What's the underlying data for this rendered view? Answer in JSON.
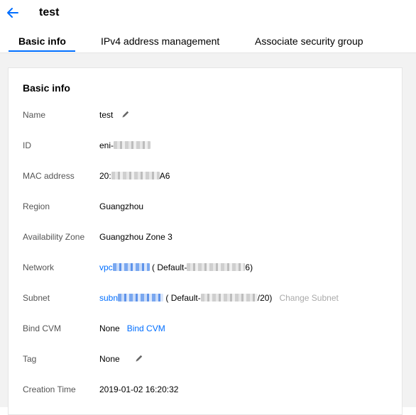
{
  "header": {
    "title": "test"
  },
  "tabs": [
    {
      "label": "Basic info"
    },
    {
      "label": "IPv4 address management"
    },
    {
      "label": "Associate security group"
    }
  ],
  "card": {
    "title": "Basic info",
    "rows": {
      "name": {
        "label": "Name",
        "value": "test"
      },
      "id": {
        "label": "ID",
        "value_prefix": "eni-"
      },
      "mac": {
        "label": "MAC address",
        "value_prefix": "20:",
        "value_suffix": "A6"
      },
      "region": {
        "label": "Region",
        "value": "Guangzhou"
      },
      "zone": {
        "label": "Availability Zone",
        "value": "Guangzhou Zone 3"
      },
      "network": {
        "label": "Network",
        "link_prefix": "vpc",
        "paren_prefix": "( Default-",
        "paren_suffix": "6)"
      },
      "subnet": {
        "label": "Subnet",
        "link_prefix": "subn",
        "paren_prefix": "( Default-",
        "paren_suffix": "/20)",
        "action": "Change Subnet"
      },
      "bind_cvm": {
        "label": "Bind CVM",
        "value": "None",
        "action": "Bind CVM"
      },
      "tag": {
        "label": "Tag",
        "value": "None"
      },
      "creation_time": {
        "label": "Creation Time",
        "value": "2019-01-02 16:20:32"
      }
    }
  },
  "colors": {
    "accent": "#006eff",
    "muted": "#aaaaaa",
    "background": "#f2f2f2"
  },
  "icons": [
    "arrow-left-icon",
    "pencil-icon"
  ]
}
